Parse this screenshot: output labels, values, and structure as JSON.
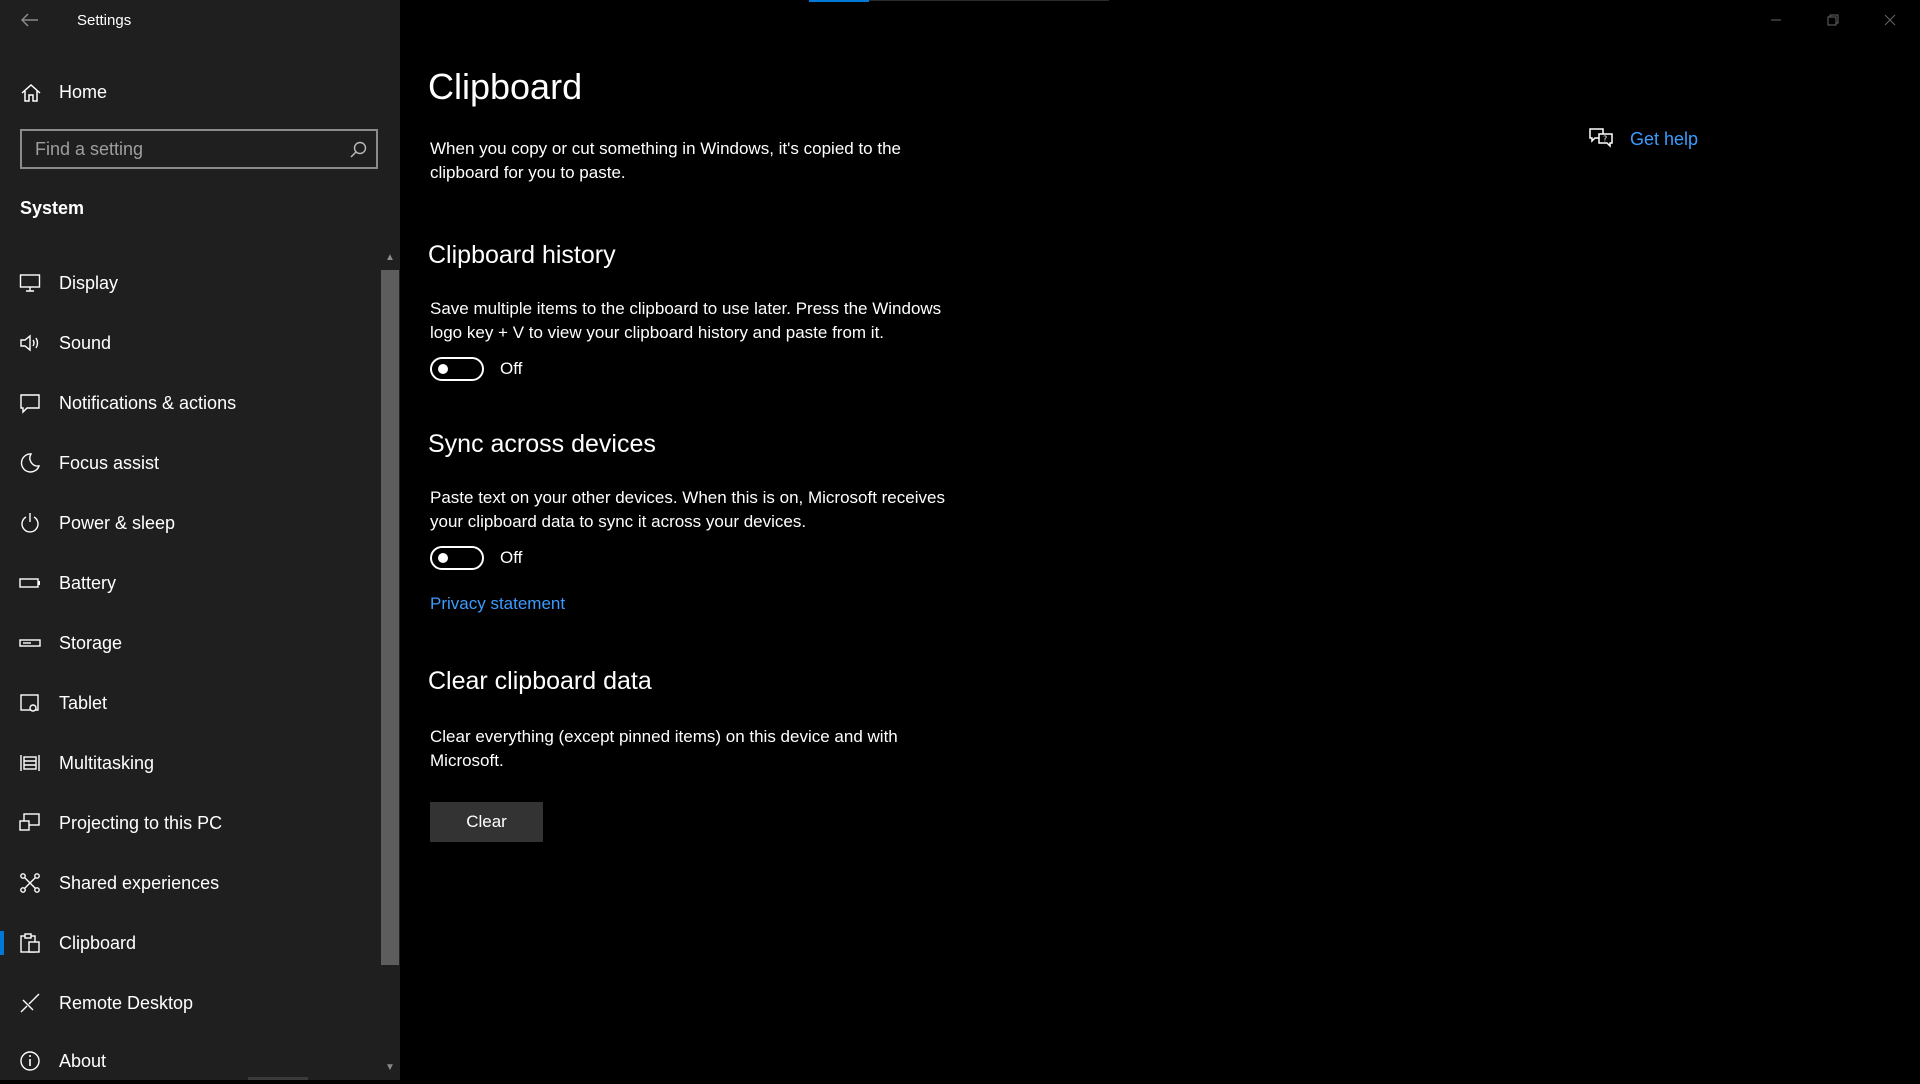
{
  "window": {
    "title": "Settings"
  },
  "sidebar": {
    "home_label": "Home",
    "search_placeholder": "Find a setting",
    "section_title": "System",
    "items": [
      {
        "label": "Display",
        "icon": "display-icon"
      },
      {
        "label": "Sound",
        "icon": "sound-icon"
      },
      {
        "label": "Notifications & actions",
        "icon": "notifications-icon"
      },
      {
        "label": "Focus assist",
        "icon": "moon-icon"
      },
      {
        "label": "Power & sleep",
        "icon": "power-icon"
      },
      {
        "label": "Battery",
        "icon": "battery-icon"
      },
      {
        "label": "Storage",
        "icon": "storage-icon"
      },
      {
        "label": "Tablet",
        "icon": "tablet-icon"
      },
      {
        "label": "Multitasking",
        "icon": "multitasking-icon"
      },
      {
        "label": "Projecting to this PC",
        "icon": "projecting-icon"
      },
      {
        "label": "Shared experiences",
        "icon": "shared-experiences-icon"
      },
      {
        "label": "Clipboard",
        "icon": "clipboard-icon",
        "active": true
      },
      {
        "label": "Remote Desktop",
        "icon": "remote-desktop-icon"
      },
      {
        "label": "About",
        "icon": "info-icon"
      }
    ]
  },
  "main": {
    "title": "Clipboard",
    "intro": "When you copy or cut something in Windows, it's copied to the clipboard for you to paste.",
    "history": {
      "heading": "Clipboard history",
      "description": "Save multiple items to the clipboard to use later. Press the Windows logo key + V to view your clipboard history and paste from it.",
      "toggle_state": "Off"
    },
    "sync": {
      "heading": "Sync across devices",
      "description": "Paste text on your other devices. When this is on, Microsoft receives your clipboard data to sync it across your devices.",
      "toggle_state": "Off",
      "privacy_link": "Privacy statement"
    },
    "clear": {
      "heading": "Clear clipboard data",
      "description": "Clear everything (except pinned items) on this device and with Microsoft.",
      "button_label": "Clear"
    },
    "help_link": "Get help"
  },
  "colors": {
    "accent": "#0078d7",
    "link": "#3b9cff",
    "sidebar_bg": "#1f1f1f",
    "main_bg": "#000000"
  }
}
